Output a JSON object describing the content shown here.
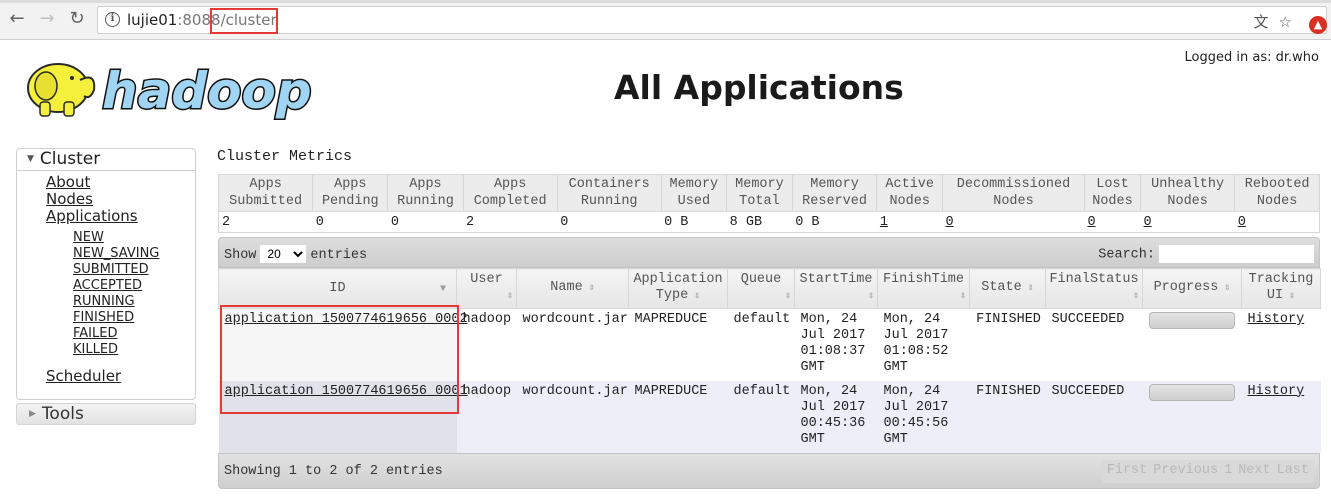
{
  "browser": {
    "url_host": "lujie01",
    "url_port": ":8088",
    "url_path": "/cluster",
    "icons": [
      "back-arrow-icon",
      "forward-arrow-icon",
      "reload-icon",
      "info-icon",
      "translate-icon",
      "star-icon",
      "extension-icon"
    ]
  },
  "header": {
    "logged_in": "Logged in as: dr.who",
    "title": "All Applications",
    "logo_text": "hadoop"
  },
  "sidebar": {
    "cluster_label": "Cluster",
    "main_links": [
      "About",
      "Nodes",
      "Applications"
    ],
    "app_states": [
      "NEW",
      "NEW_SAVING",
      "SUBMITTED",
      "ACCEPTED",
      "RUNNING",
      "FINISHED",
      "FAILED",
      "KILLED"
    ],
    "scheduler_label": "Scheduler",
    "tools_label": "Tools"
  },
  "metrics": {
    "title": "Cluster Metrics",
    "headers": [
      [
        "Apps",
        "Submitted"
      ],
      [
        "Apps",
        "Pending"
      ],
      [
        "Apps",
        "Running"
      ],
      [
        "Apps",
        "Completed"
      ],
      [
        "Containers",
        "Running"
      ],
      [
        "Memory",
        "Used"
      ],
      [
        "Memory",
        "Total"
      ],
      [
        "Memory",
        "Reserved"
      ],
      [
        "Active",
        "Nodes"
      ],
      [
        "Decommissioned",
        "Nodes"
      ],
      [
        "Lost",
        "Nodes"
      ],
      [
        "Unhealthy",
        "Nodes"
      ],
      [
        "Rebooted",
        "Nodes"
      ]
    ],
    "values": [
      "2",
      "0",
      "0",
      "2",
      "0",
      "0 B",
      "8 GB",
      "0 B",
      "1",
      "0",
      "0",
      "0",
      "0"
    ]
  },
  "apps_table": {
    "show_label": "Show",
    "entries_label": "entries",
    "page_size": "20",
    "search_label": "Search:",
    "search_value": "",
    "columns": [
      [
        "ID",
        ""
      ],
      [
        "User",
        ""
      ],
      [
        "Name",
        ""
      ],
      [
        "Application",
        "Type"
      ],
      [
        "Queue",
        ""
      ],
      [
        "StartTime",
        ""
      ],
      [
        "FinishTime",
        ""
      ],
      [
        "State",
        ""
      ],
      [
        "FinalStatus",
        ""
      ],
      [
        "Progress",
        ""
      ],
      [
        "Tracking",
        "UI"
      ]
    ],
    "rows": [
      {
        "id": "application_1500774619656_0002",
        "user": "hadoop",
        "name": "wordcount.jar",
        "type": "MAPREDUCE",
        "queue": "default",
        "start": [
          "Mon, 24",
          "Jul 2017",
          "01:08:37",
          "GMT"
        ],
        "finish": [
          "Mon, 24",
          "Jul 2017",
          "01:08:52",
          "GMT"
        ],
        "state": "FINISHED",
        "final_status": "SUCCEEDED",
        "progress": 0,
        "tracking": "History"
      },
      {
        "id": "application_1500774619656_0001",
        "user": "hadoop",
        "name": "wordcount.jar",
        "type": "MAPREDUCE",
        "queue": "default",
        "start": [
          "Mon, 24",
          "Jul 2017",
          "00:45:36",
          "GMT"
        ],
        "finish": [
          "Mon, 24",
          "Jul 2017",
          "00:45:56",
          "GMT"
        ],
        "state": "FINISHED",
        "final_status": "SUCCEEDED",
        "progress": 0,
        "tracking": "History"
      }
    ],
    "footer_info": "Showing 1 to 2 of 2 entries",
    "paging": [
      "First",
      "Previous",
      "1",
      "Next",
      "Last"
    ]
  },
  "colors": {
    "highlight_box": "#e53935",
    "row_even": "#eeeef9",
    "logo_blue": "#9fd4f2",
    "logo_yellow": "#f4f03c"
  }
}
